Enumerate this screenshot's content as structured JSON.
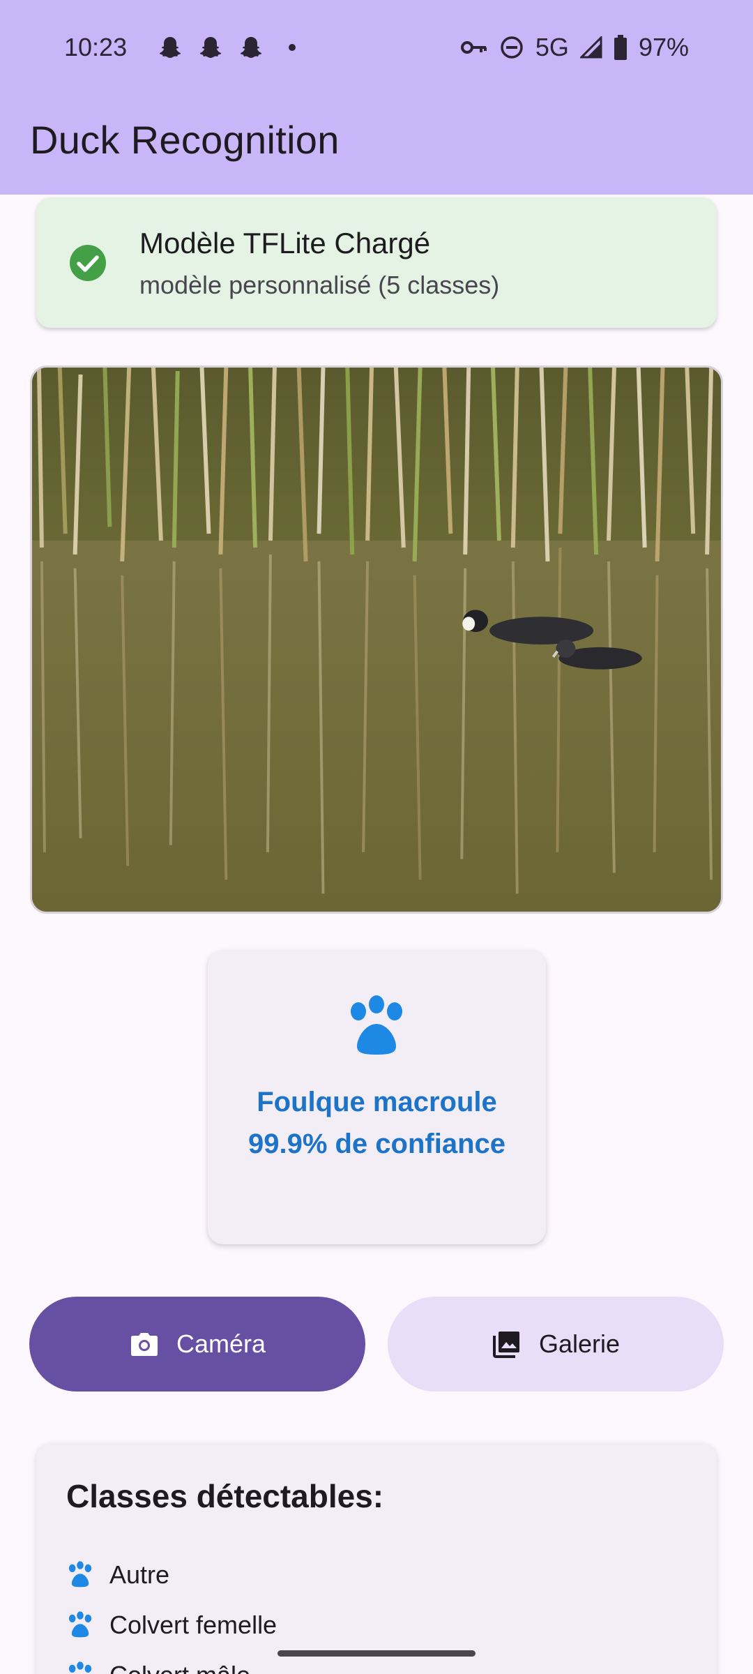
{
  "status_bar": {
    "time": "10:23",
    "network": "5G",
    "battery": "97%",
    "icons": [
      "snapchat-icon",
      "snapchat-icon",
      "snapchat-icon",
      "dot-icon",
      "vpn-key-icon",
      "do-not-disturb-icon",
      "signal-icon",
      "battery-icon"
    ]
  },
  "app_bar": {
    "title": "Duck Recognition"
  },
  "model_status": {
    "title": "Modèle TFLite Chargé",
    "subtitle": "modèle personnalisé (5 classes)",
    "icon": "check-circle-icon"
  },
  "result": {
    "species": "Foulque macroule",
    "confidence": "99.9% de confiance",
    "icon": "paw-icon"
  },
  "buttons": {
    "camera": "Caméra",
    "gallery": "Galerie"
  },
  "classes": {
    "title": "Classes détectables:",
    "items": [
      "Autre",
      "Colvert femelle",
      "Colvert mâle"
    ]
  },
  "colors": {
    "app_bar": "#C8B6F8",
    "primary": "#6750A4",
    "secondary_container": "#E8DEF8",
    "success_bg": "#E5F3E4",
    "success": "#43A047",
    "accent_blue": "#1C73C8"
  }
}
